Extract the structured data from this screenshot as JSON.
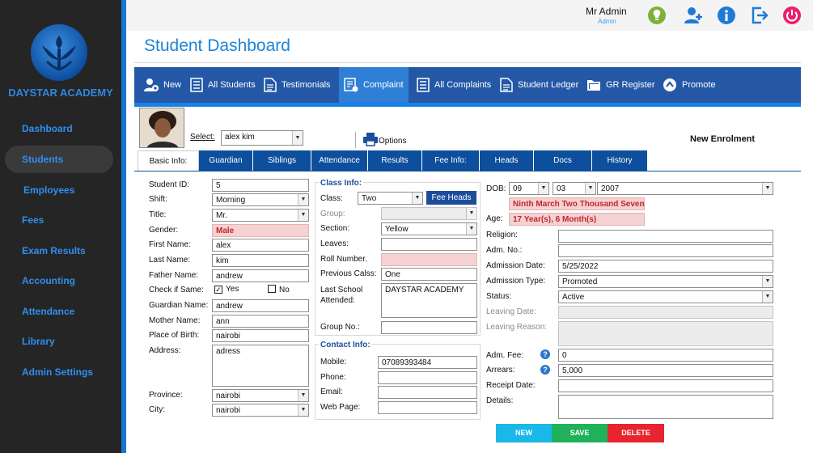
{
  "app": {
    "brand": "DAYSTAR ACADEMY"
  },
  "sidebar": {
    "items": [
      {
        "label": "Dashboard"
      },
      {
        "label": "Students"
      },
      {
        "label": "Employees"
      },
      {
        "label": "Fees"
      },
      {
        "label": "Exam Results"
      },
      {
        "label": "Accounting"
      },
      {
        "label": "Attendance"
      },
      {
        "label": "Library"
      },
      {
        "label": "Admin Settings"
      }
    ]
  },
  "header": {
    "user": "Mr Admin",
    "role": "Admin",
    "title": "Student Dashboard",
    "icons": [
      "lightbulb-icon",
      "add-user-icon",
      "info-icon",
      "logout-icon",
      "power-icon"
    ],
    "icon_colors": {
      "lightbulb": "#7db13a",
      "blue": "#1f7ad6",
      "power": "#e8206f"
    }
  },
  "toolbar": {
    "items": [
      {
        "label": "New"
      },
      {
        "label": "All Students"
      },
      {
        "label": "Testimonials"
      },
      {
        "label": "Complaint"
      },
      {
        "label": "All Complaints"
      },
      {
        "label": "Student Ledger"
      },
      {
        "label": "GR Register"
      },
      {
        "label": "Promote"
      }
    ]
  },
  "selector": {
    "label": "Select:",
    "value": "alex kim",
    "options_label": "Options",
    "new_enrolment": "New Enrolment"
  },
  "tabs": [
    {
      "label": "Basic Info:"
    },
    {
      "label": "Guardian"
    },
    {
      "label": "Siblings"
    },
    {
      "label": "Attendance"
    },
    {
      "label": "Results"
    },
    {
      "label": "Fee Info:"
    },
    {
      "label": "Heads"
    },
    {
      "label": "Docs"
    },
    {
      "label": "History"
    }
  ],
  "basic": {
    "student_id_label": "Student ID:",
    "student_id": "5",
    "shift_label": "Shift:",
    "shift": "Morning",
    "title_label": "Title:",
    "title": "Mr.",
    "gender_label": "Gender:",
    "gender": "Male",
    "first_name_label": "First Name:",
    "first_name": "alex",
    "last_name_label": "Last Name:",
    "last_name": "kim",
    "father_label": "Father Name:",
    "father": "andrew",
    "check_label": "Check if Same:",
    "yes_label": "Yes",
    "no_label": "No",
    "guardian_label": "Guardian Name:",
    "guardian": "andrew",
    "mother_label": "Mother Name:",
    "mother": "ann",
    "pob_label": "Place of Birth:",
    "pob": "nairobi",
    "address_label": "Address:",
    "address": "adress",
    "province_label": "Province:",
    "province": "nairobi",
    "city_label": "City:",
    "city": "nairobi"
  },
  "class_info": {
    "title": "Class Info:",
    "class_label": "Class:",
    "class": "Two",
    "fee_heads": "Fee Heads",
    "group_label": "Group:",
    "group": "",
    "section_label": "Section:",
    "section": "Yellow",
    "leaves_label": "Leaves:",
    "leaves": "",
    "roll_label": "Roll Number.",
    "roll": "",
    "prev_class_label": "Previous Calss:",
    "prev_class": "One",
    "last_school_label": "Last School Attended:",
    "last_school": "DAYSTAR ACADEMY",
    "group_no_label": "Group No.:",
    "group_no": ""
  },
  "contact": {
    "title": "Contact Info:",
    "mobile_label": "Mobile:",
    "mobile": "07089393484",
    "phone_label": "Phone:",
    "phone": "",
    "email_label": "Email:",
    "email": "",
    "web_label": "Web Page:",
    "web": ""
  },
  "right": {
    "dob_label": "DOB:",
    "dob_day": "09",
    "dob_month": "03",
    "dob_year": "2007",
    "dob_words": "Ninth March Two Thousand Seven",
    "age_label": "Age:",
    "age": "17 Year(s), 6 Month(s)",
    "religion_label": "Religion:",
    "religion": "",
    "adm_no_label": "Adm. No.:",
    "adm_no": "",
    "adm_date_label": "Admission Date:",
    "adm_date": "5/25/2022",
    "adm_type_label": "Admission Type:",
    "adm_type": "Promoted",
    "status_label": "Status:",
    "status": "Active",
    "leaving_date_label": "Leaving Date:",
    "leaving_date": "",
    "leaving_reason_label": "Leaving Reason:",
    "leaving_reason": "",
    "adm_fee_label": "Adm. Fee:",
    "adm_fee": "0",
    "arrears_label": "Arrears:",
    "arrears": "5,000",
    "receipt_label": "Receipt Date:",
    "receipt": "",
    "details_label": "Details:",
    "details": ""
  },
  "actions": {
    "new": "NEW",
    "save": "SAVE",
    "delete": "DELETE",
    "colors": {
      "new": "#19b8e8",
      "save": "#1fb25a",
      "delete": "#e8242f"
    }
  }
}
